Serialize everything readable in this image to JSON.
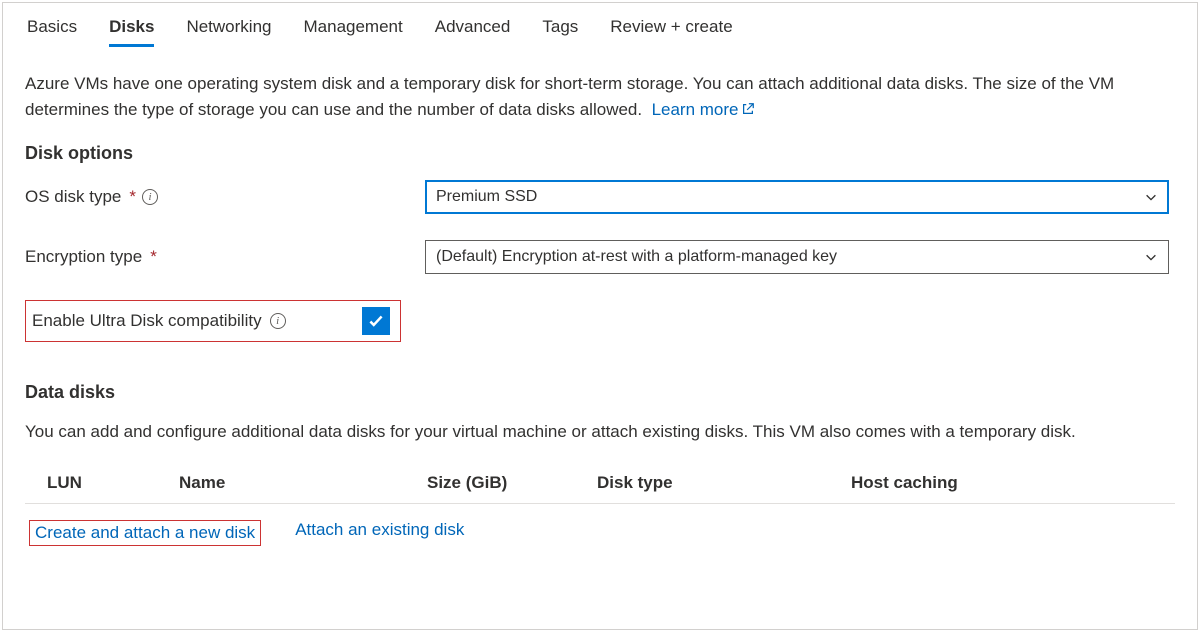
{
  "tabs": {
    "items": [
      "Basics",
      "Disks",
      "Networking",
      "Management",
      "Advanced",
      "Tags",
      "Review + create"
    ],
    "active_index": 1
  },
  "intro": {
    "text": "Azure VMs have one operating system disk and a temporary disk for short-term storage. You can attach additional data disks. The size of the VM determines the type of storage you can use and the number of data disks allowed.",
    "link_label": "Learn more"
  },
  "sections": {
    "disk_options_heading": "Disk options",
    "data_disks_heading": "Data disks"
  },
  "form": {
    "os_disk_label": "OS disk type",
    "os_disk_value": "Premium SSD",
    "encryption_label": "Encryption type",
    "encryption_value": "(Default) Encryption at-rest with a platform-managed key",
    "ultra_label": "Enable Ultra Disk compatibility",
    "ultra_checked": true
  },
  "data_disks": {
    "description": "You can add and configure additional data disks for your virtual machine or attach existing disks. This VM also comes with a temporary disk.",
    "columns": {
      "lun": "LUN",
      "name": "Name",
      "size": "Size (GiB)",
      "type": "Disk type",
      "cache": "Host caching"
    },
    "actions": {
      "create": "Create and attach a new disk",
      "attach": "Attach an existing disk"
    }
  }
}
